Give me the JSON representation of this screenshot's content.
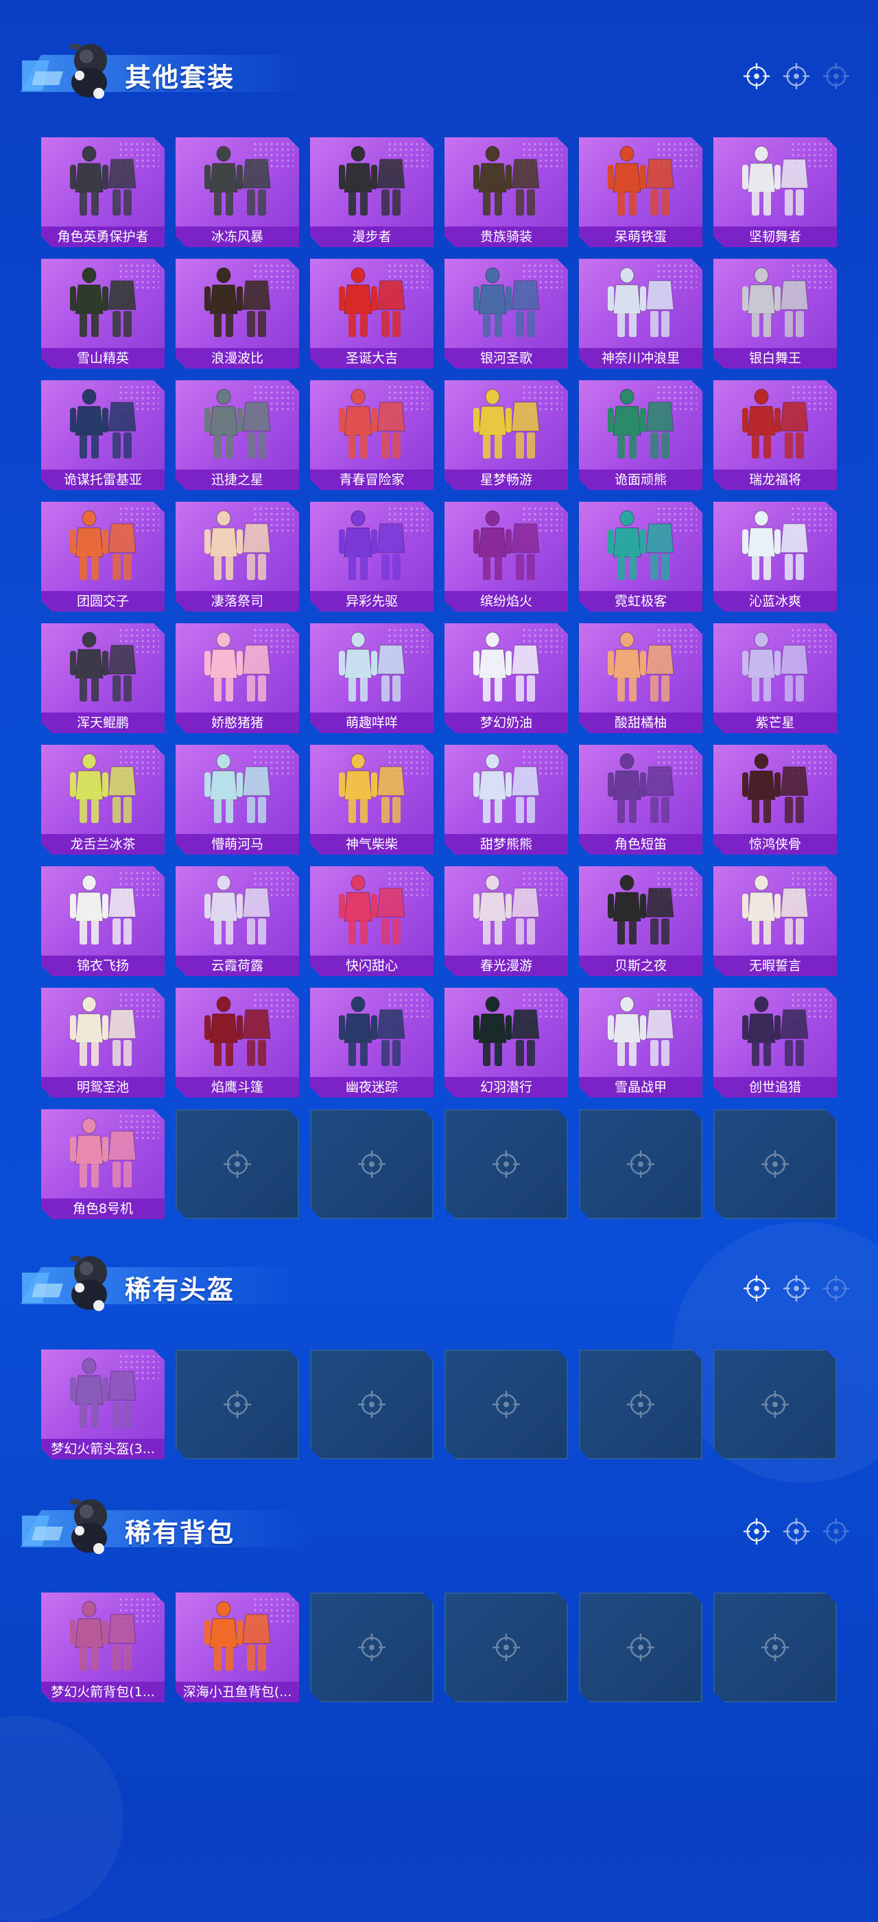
{
  "sections": [
    {
      "title": "其他套装",
      "items": [
        {
          "name": "角色英勇保护者",
          "color": "#3b3b48"
        },
        {
          "name": "冰冻风暴",
          "color": "#3f4446"
        },
        {
          "name": "漫步者",
          "color": "#2f3136"
        },
        {
          "name": "贵族骑装",
          "color": "#4a3a2a"
        },
        {
          "name": "呆萌铁蛋",
          "color": "#d84a2a"
        },
        {
          "name": "坚韧舞者",
          "color": "#e8e8ee"
        },
        {
          "name": "雪山精英",
          "color": "#2e3a2a"
        },
        {
          "name": "浪漫波比",
          "color": "#3a2a20"
        },
        {
          "name": "圣诞大吉",
          "color": "#d82a2a"
        },
        {
          "name": "银河圣歌",
          "color": "#4a6aa8"
        },
        {
          "name": "神奈川冲浪里",
          "color": "#d8e0f0"
        },
        {
          "name": "银白舞王",
          "color": "#c8c8d0"
        },
        {
          "name": "诡谋托雷基亚",
          "color": "#283a6a"
        },
        {
          "name": "迅捷之星",
          "color": "#6a7a80"
        },
        {
          "name": "青春冒险家",
          "color": "#e05050"
        },
        {
          "name": "星梦畅游",
          "color": "#e8c840"
        },
        {
          "name": "诡面顽熊",
          "color": "#2a8a6a"
        },
        {
          "name": "瑞龙福将",
          "color": "#b8282a"
        },
        {
          "name": "团圆交子",
          "color": "#e86a3a"
        },
        {
          "name": "凄落祭司",
          "color": "#f0d0b8"
        },
        {
          "name": "异彩先驱",
          "color": "#7a3ad8"
        },
        {
          "name": "缤纷焰火",
          "color": "#8a2a9a"
        },
        {
          "name": "霓虹极客",
          "color": "#2aa8a0"
        },
        {
          "name": "沁蓝冰爽",
          "color": "#e8f0f8"
        },
        {
          "name": "浑天鲲鹏",
          "color": "#3a3a48"
        },
        {
          "name": "娇憨猪猪",
          "color": "#f8b8d0"
        },
        {
          "name": "萌趣咩咩",
          "color": "#c8e0f0"
        },
        {
          "name": "梦幻奶油",
          "color": "#f0f0f8"
        },
        {
          "name": "酸甜橘柚",
          "color": "#f0a878"
        },
        {
          "name": "紫芒星",
          "color": "#c8b8f0"
        },
        {
          "name": "龙舌兰冰茶",
          "color": "#d8e060"
        },
        {
          "name": "懵萌河马",
          "color": "#b8e0e8"
        },
        {
          "name": "神气柴柴",
          "color": "#f0c048"
        },
        {
          "name": "甜梦熊熊",
          "color": "#d8e0f8"
        },
        {
          "name": "角色短笛",
          "color": "#6a3a9a"
        },
        {
          "name": "惊鸿侠骨",
          "color": "#4a2028"
        },
        {
          "name": "锦衣飞扬",
          "color": "#f0f0f0"
        },
        {
          "name": "云霞荷露",
          "color": "#e0d8f0"
        },
        {
          "name": "快闪甜心",
          "color": "#e03a6a"
        },
        {
          "name": "春光漫游",
          "color": "#e8d8e8"
        },
        {
          "name": "贝斯之夜",
          "color": "#2a2a2a"
        },
        {
          "name": "无暇誓言",
          "color": "#f0e8e0"
        },
        {
          "name": "明鸳圣池",
          "color": "#f0e8d8"
        },
        {
          "name": "焰鹰斗篷",
          "color": "#8a1a28"
        },
        {
          "name": "幽夜迷踪",
          "color": "#2a3a6a"
        },
        {
          "name": "幻羽潜行",
          "color": "#1a2a2a"
        },
        {
          "name": "雪晶战甲",
          "color": "#e8e8f0"
        },
        {
          "name": "创世追猎",
          "color": "#3a2a5a"
        },
        {
          "name": "角色8号机",
          "color": "#e88ab0"
        }
      ],
      "empty_count": 5
    },
    {
      "title": "稀有头盔",
      "items": [
        {
          "name": "梦幻火箭头盔(3...",
          "color": "#8a5ab8"
        }
      ],
      "empty_count": 5
    },
    {
      "title": "稀有背包",
      "items": [
        {
          "name": "梦幻火箭背包(1...",
          "color": "#b85a9a"
        },
        {
          "name": "深海小丑鱼背包(...",
          "color": "#f06a2a"
        }
      ],
      "empty_count": 4
    }
  ]
}
